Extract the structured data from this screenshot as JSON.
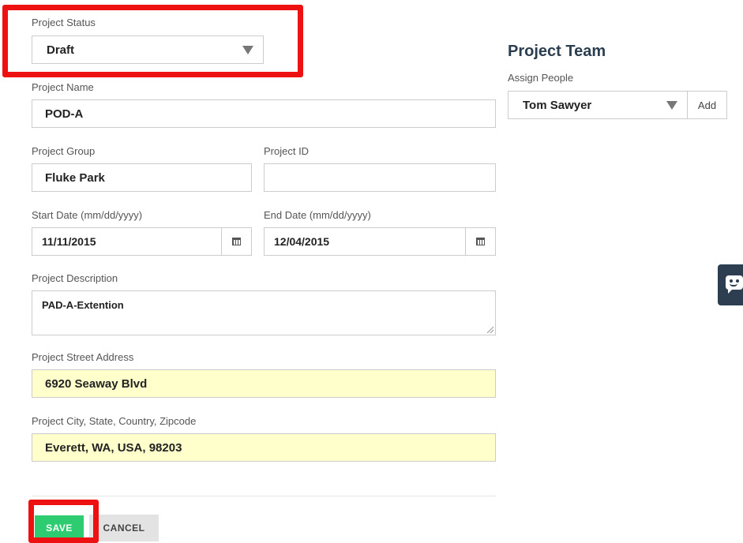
{
  "form": {
    "status": {
      "label": "Project Status",
      "value": "Draft"
    },
    "name": {
      "label": "Project Name",
      "value": "POD-A"
    },
    "group": {
      "label": "Project Group",
      "value": "Fluke Park"
    },
    "project_id": {
      "label": "Project ID",
      "value": ""
    },
    "start_date": {
      "label": "Start Date (mm/dd/yyyy)",
      "value": "11/11/2015"
    },
    "end_date": {
      "label": "End Date (mm/dd/yyyy)",
      "value": "12/04/2015"
    },
    "description": {
      "label": "Project Description",
      "value": "PAD-A-Extention"
    },
    "street": {
      "label": "Project Street Address",
      "value": "6920 Seaway Blvd"
    },
    "city": {
      "label": "Project City, State, Country, Zipcode",
      "value": "Everett, WA, USA, 98203"
    }
  },
  "team": {
    "title": "Project Team",
    "assign_label": "Assign People",
    "selected": "Tom Sawyer",
    "add_label": "Add"
  },
  "actions": {
    "save_label": "SAVE",
    "cancel_label": "CANCEL"
  },
  "colors": {
    "highlight": "#ee1111",
    "save": "#2ecc71",
    "address_bg": "#ffffcc",
    "team_title": "#2b3e50",
    "chat_widget": "#2c3e50"
  },
  "icons": [
    "chevron-down-icon",
    "calendar-icon",
    "chat-icon"
  ]
}
